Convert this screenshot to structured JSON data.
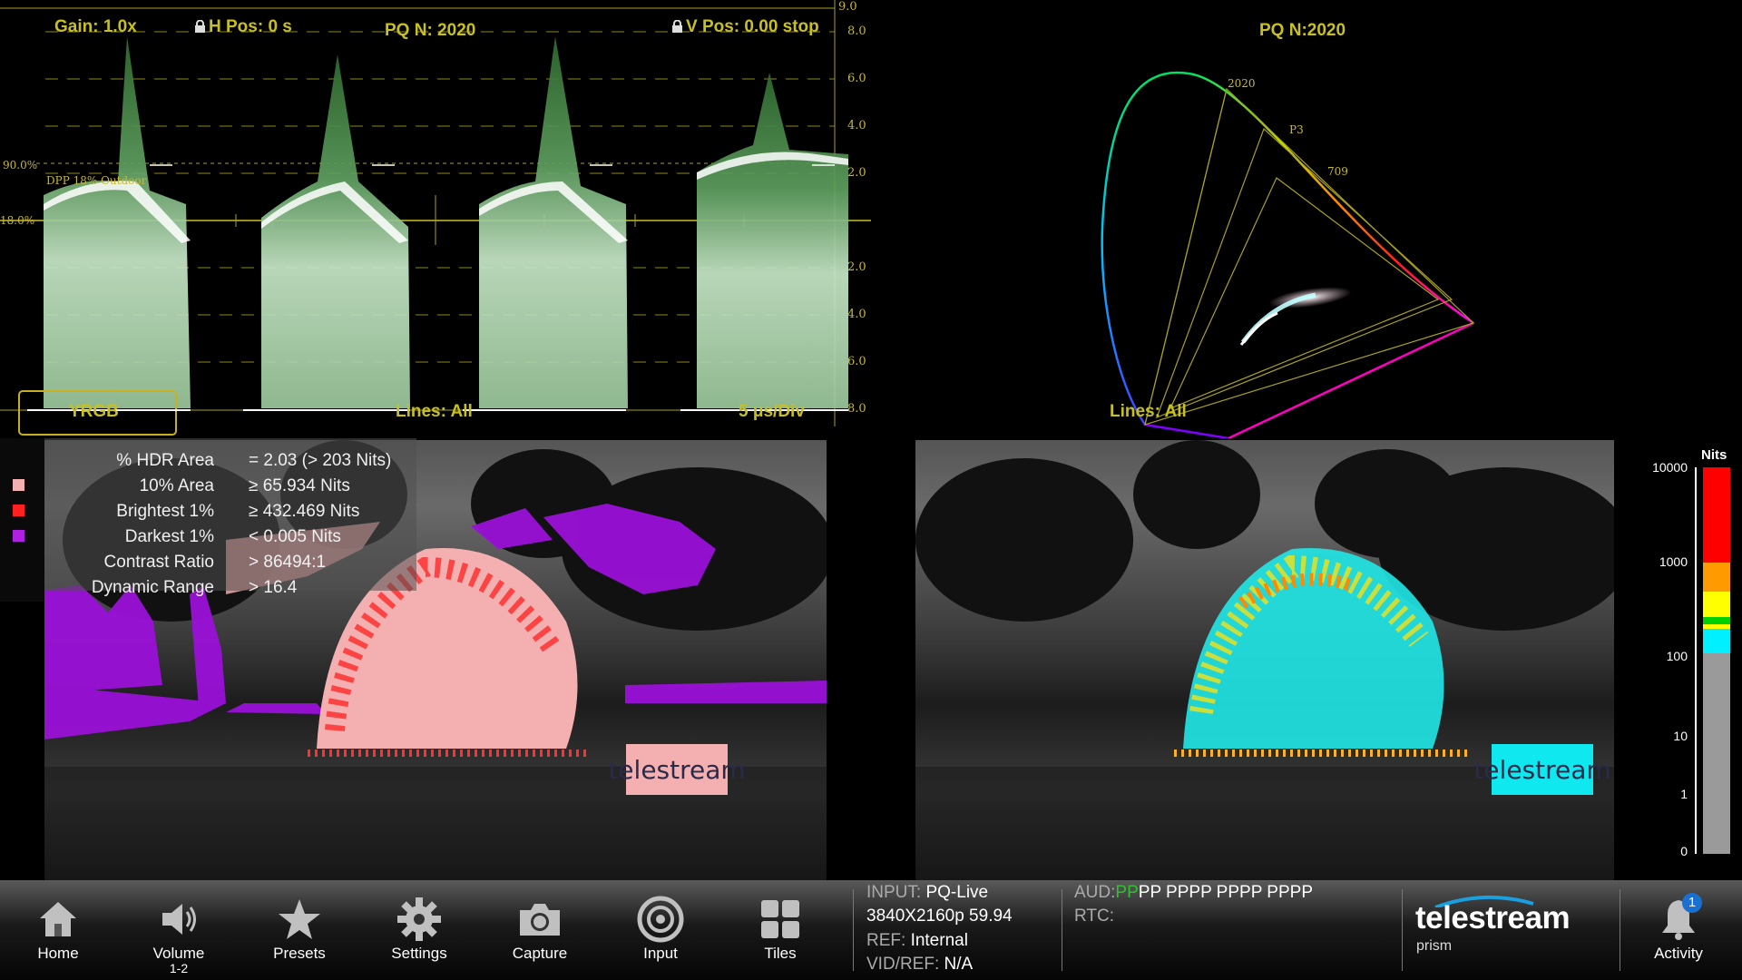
{
  "waveform": {
    "gain": "Gain: 1.0x",
    "hpos": "H Pos: 0 s",
    "title": "PQ N: 2020",
    "vpos": "V Pos: 0.00 stop",
    "mode": "YRGB",
    "lines": "Lines: All",
    "sweep": "5 μs/Div",
    "ref_high": "90.0%",
    "ref_mid": "18.0%",
    "dpp": "DPP 18% Outdoor",
    "scale": [
      "9.0",
      "8.0",
      "6.0",
      "4.0",
      "2.0",
      "2.0",
      "4.0",
      "6.0",
      "8.0"
    ]
  },
  "gamut": {
    "title": "PQ N:2020",
    "lines": "Lines: All",
    "labels": [
      "2020",
      "P3",
      "709"
    ]
  },
  "stats": {
    "rows": [
      {
        "label": "% HDR Area",
        "value": "= 2.03 (> 203 Nits)"
      },
      {
        "label": "10% Area",
        "value": "≥ 65.934 Nits"
      },
      {
        "label": "Brightest 1%",
        "value": "≥ 432.469 Nits"
      },
      {
        "label": "Darkest 1%",
        "value": "< 0.005 Nits"
      },
      {
        "label": "Contrast Ratio",
        "value": "> 86494:1"
      },
      {
        "label": "Dynamic Range",
        "value": "> 16.4"
      }
    ],
    "legend_colors": [
      "#f4b0b0",
      "#ff2020",
      "#b020e0"
    ]
  },
  "logo_text": "telestream",
  "nits_scale": {
    "title": "Nits",
    "ticks": [
      "10000",
      "1000",
      "100",
      "10",
      "1",
      "0"
    ]
  },
  "toolbar": {
    "buttons": [
      {
        "label": "Home",
        "sub": ""
      },
      {
        "label": "Volume",
        "sub": "1-2"
      },
      {
        "label": "Presets",
        "sub": ""
      },
      {
        "label": "Settings",
        "sub": ""
      },
      {
        "label": "Capture",
        "sub": ""
      },
      {
        "label": "Input",
        "sub": ""
      },
      {
        "label": "Tiles",
        "sub": ""
      }
    ],
    "input_key": "INPUT:",
    "input_val": "PQ-Live",
    "format": "3840X2160p 59.94",
    "ref_key": "REF:",
    "ref_val": "Internal",
    "vidref_key": "VID/REF:",
    "vidref_val": "N/A",
    "aud_key": "AUD:",
    "aud_green": "PP",
    "aud_rest": "PP PPPP PPPP PPPP",
    "rtc_key": "RTC:",
    "brand": "telestream",
    "brand_sub": "prism",
    "activity_label": "Activity",
    "activity_count": "1"
  }
}
